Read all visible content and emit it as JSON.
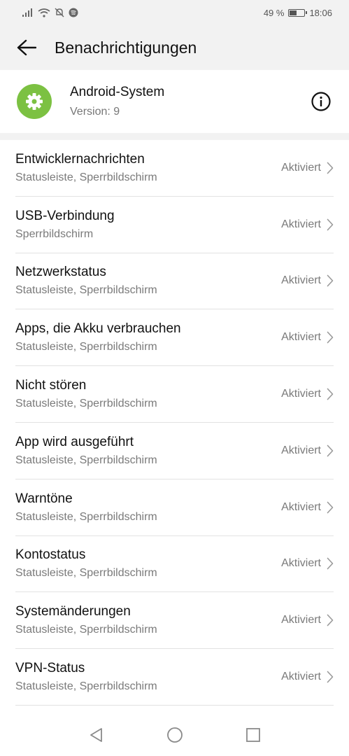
{
  "statusbar": {
    "battery_text": "49 %",
    "battery_level": 0.49,
    "time": "18:06",
    "icons": [
      "signal-icon",
      "wifi-icon",
      "mute-notifications-icon",
      "spotify-icon",
      "battery-icon"
    ]
  },
  "appbar": {
    "title": "Benachrichtigungen",
    "back_icon": "back-arrow-icon"
  },
  "app": {
    "name": "Android-System",
    "version": "Version: 9",
    "icon": "gear-icon",
    "icon_color": "#7cc142",
    "info_icon": "info-icon"
  },
  "channels": [
    {
      "title": "Entwicklernachrichten",
      "subtitle": "Statusleiste, Sperrbildschirm",
      "status": "Aktiviert"
    },
    {
      "title": "USB-Verbindung",
      "subtitle": "Sperrbildschirm",
      "status": "Aktiviert"
    },
    {
      "title": "Netzwerkstatus",
      "subtitle": "Statusleiste, Sperrbildschirm",
      "status": "Aktiviert"
    },
    {
      "title": "Apps, die Akku verbrauchen",
      "subtitle": "Statusleiste, Sperrbildschirm",
      "status": "Aktiviert"
    },
    {
      "title": "Nicht stören",
      "subtitle": "Statusleiste, Sperrbildschirm",
      "status": "Aktiviert"
    },
    {
      "title": "App wird ausgeführt",
      "subtitle": "Statusleiste, Sperrbildschirm",
      "status": "Aktiviert"
    },
    {
      "title": "Warntöne",
      "subtitle": "Statusleiste, Sperrbildschirm",
      "status": "Aktiviert"
    },
    {
      "title": "Kontostatus",
      "subtitle": "Statusleiste, Sperrbildschirm",
      "status": "Aktiviert"
    },
    {
      "title": "Systemänderungen",
      "subtitle": "Statusleiste, Sperrbildschirm",
      "status": "Aktiviert"
    },
    {
      "title": "VPN-Status",
      "subtitle": "Statusleiste, Sperrbildschirm",
      "status": "Aktiviert"
    }
  ],
  "navbar": {
    "icons": [
      "nav-back-icon",
      "nav-home-icon",
      "nav-recents-icon"
    ]
  }
}
